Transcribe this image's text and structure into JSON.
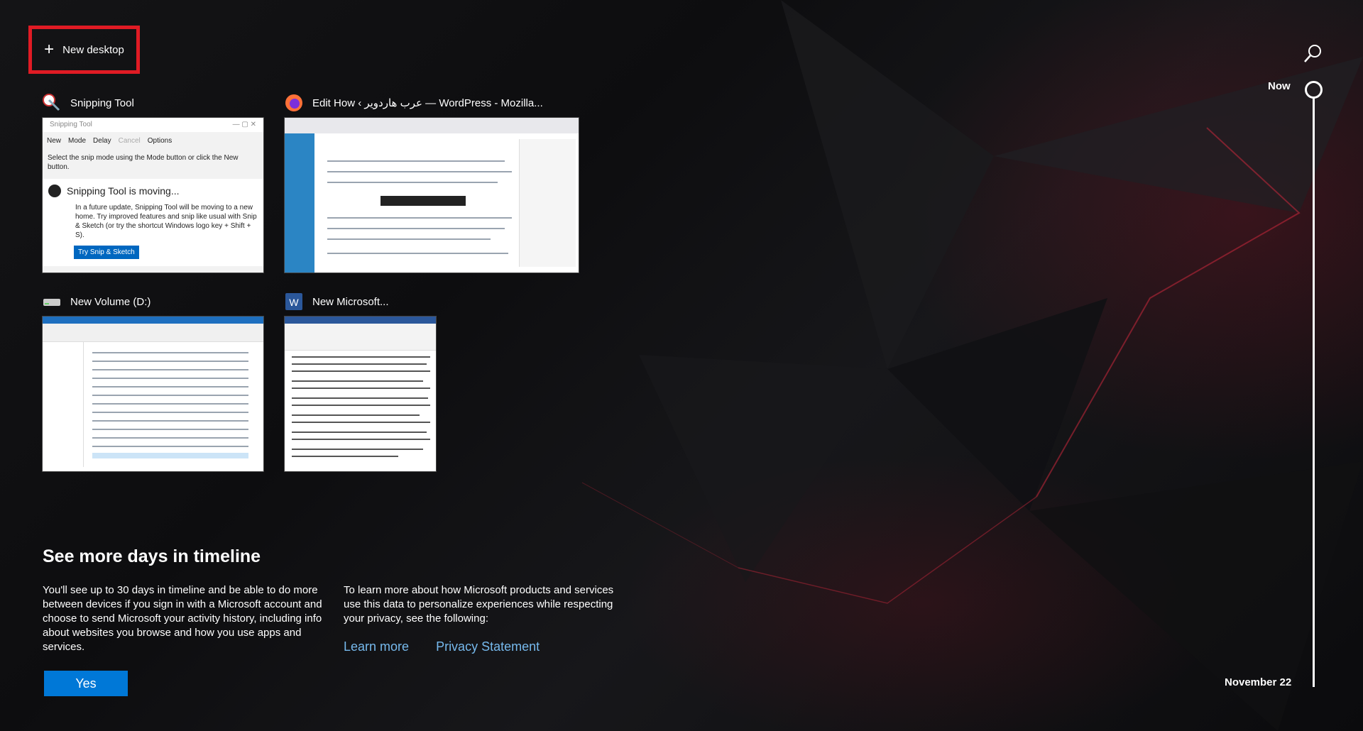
{
  "new_desktop": {
    "label": "New desktop"
  },
  "timeline": {
    "now_label": "Now",
    "date_label": "November 22"
  },
  "windows": [
    {
      "title": "Snipping Tool",
      "icon": "snipping-tool-icon"
    },
    {
      "title": "Edit How ‹ عرب هاردوير — WordPress - Mozilla...",
      "icon": "firefox-icon"
    },
    {
      "title": "New Volume (D:)",
      "icon": "drive-icon"
    },
    {
      "title": "New Microsoft...",
      "icon": "word-icon"
    }
  ],
  "snipping_tool": {
    "window_title": "Snipping Tool",
    "toolbar": [
      "New",
      "Mode",
      "Delay",
      "Cancel",
      "Options"
    ],
    "description": "Select the snip mode using the Mode button or click the New button.",
    "notice_title": "Snipping Tool is moving...",
    "notice_text": "In a future update, Snipping Tool will be moving to a new home. Try improved features and snip like usual with Snip & Sketch (or try the shortcut Windows logo key + Shift + S).",
    "notice_button": "Try Snip & Sketch"
  },
  "more_days": {
    "title": "See more days in timeline",
    "left_text": "You'll see up to 30 days in timeline and be able to do more between devices if you sign in with a Microsoft account and choose to send Microsoft your activity history, including info about websites you browse and how you use apps and services.",
    "right_text": "To learn more about how Microsoft products and services use this data to personalize experiences while respecting your privacy, see the following:",
    "learn_more": "Learn more",
    "privacy": "Privacy Statement",
    "yes": "Yes"
  }
}
